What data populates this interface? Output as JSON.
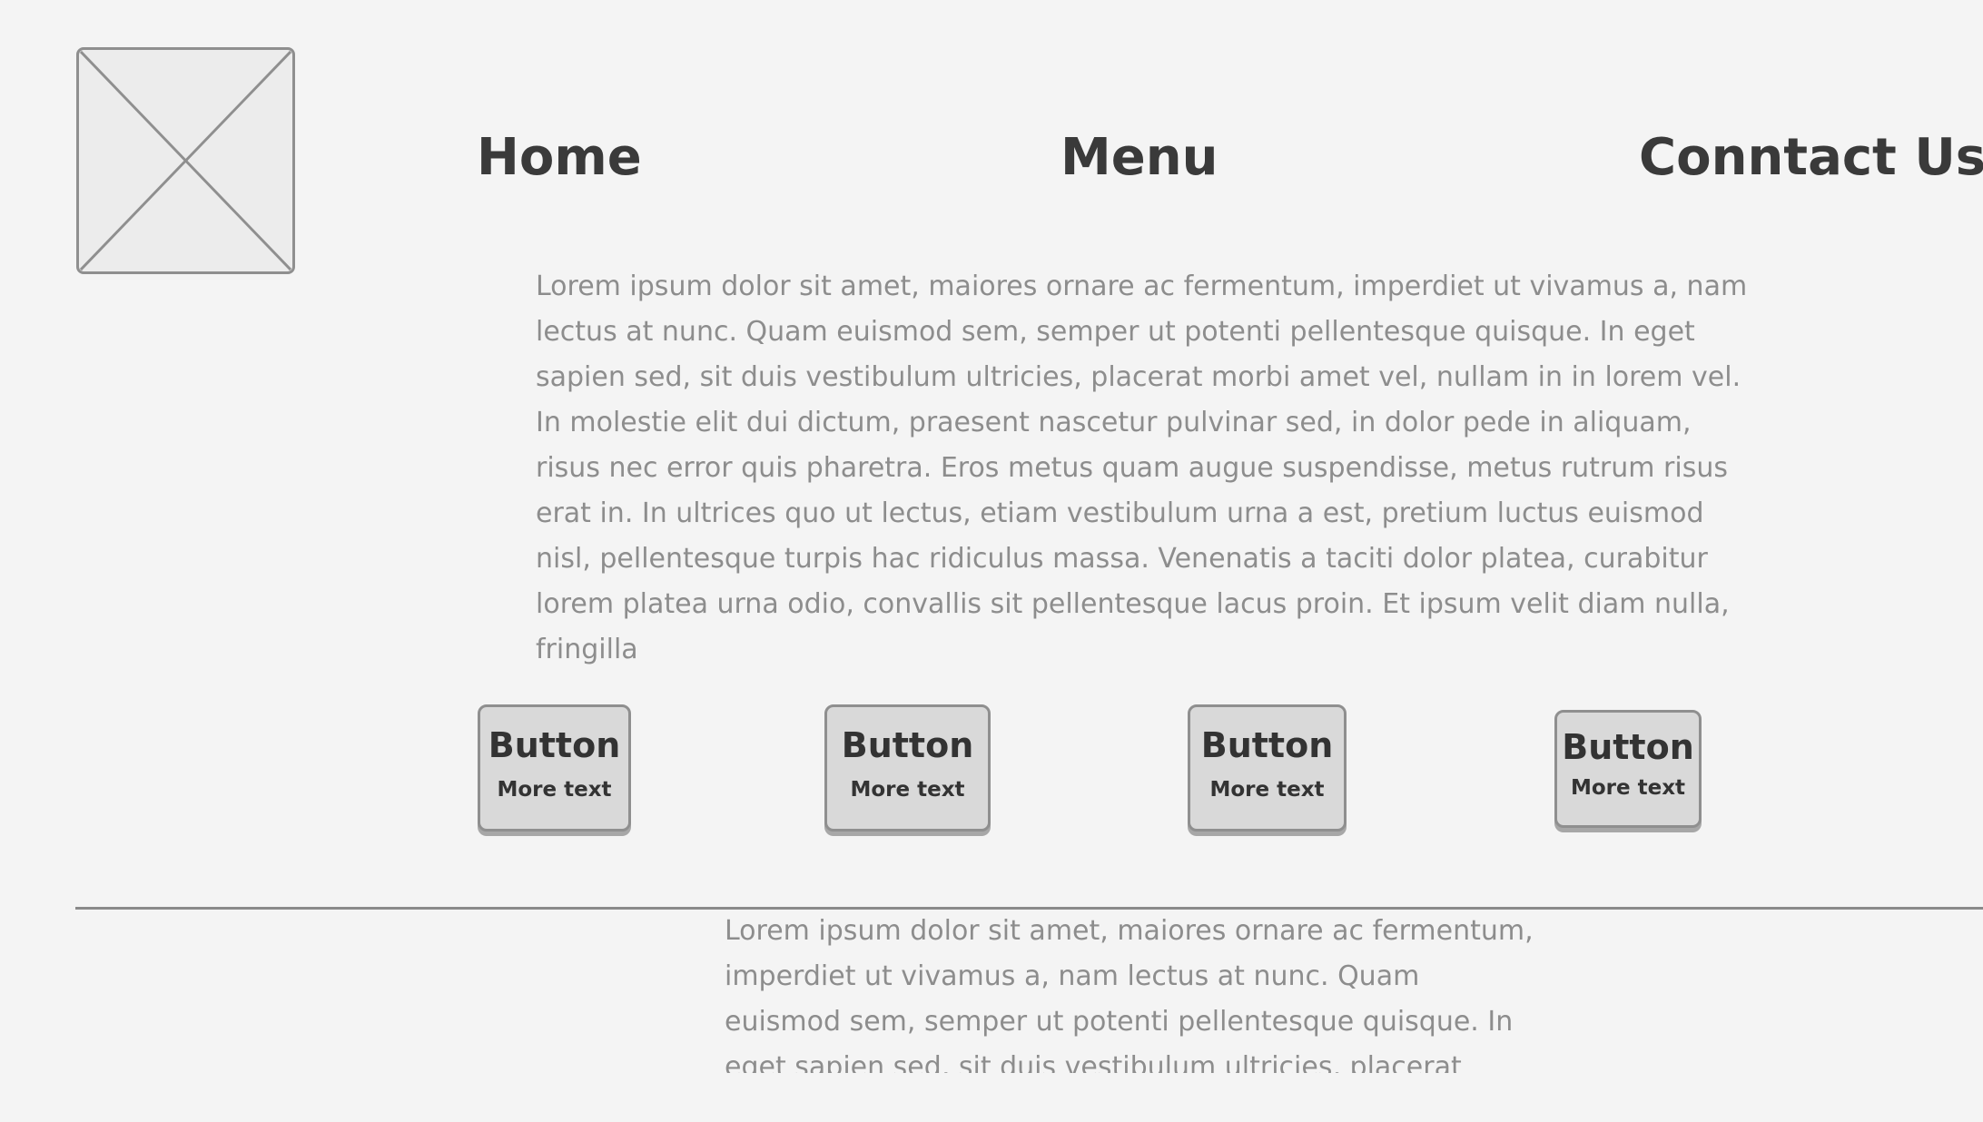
{
  "header": {
    "logo_icon": "image-placeholder-icon",
    "nav": {
      "home": "Home",
      "menu": "Menu",
      "contact": "Conntact Us"
    }
  },
  "intro": {
    "text": "Lorem ipsum dolor sit amet, maiores ornare ac fermentum, imperdiet ut vivamus a, nam lectus at nunc. Quam euismod sem, semper ut potenti pellentesque quisque. In eget sapien sed, sit duis vestibulum ultricies, placerat morbi amet vel, nullam in in lorem vel. In molestie elit dui dictum, praesent nascetur pulvinar sed, in dolor pede in aliquam, risus nec error quis pharetra. Eros metus quam augue suspendisse, metus rutrum risus erat in.  In ultrices quo ut lectus, etiam vestibulum urna a est, pretium luctus euismod nisl, pellentesque turpis hac ridiculus massa. Venenatis a taciti dolor platea, curabitur lorem platea urna odio, convallis sit pellentesque lacus proin. Et ipsum velit diam nulla, fringilla"
  },
  "buttons": [
    {
      "title": "Button",
      "sub": "More text"
    },
    {
      "title": "Button",
      "sub": "More text"
    },
    {
      "title": "Button",
      "sub": "More text"
    },
    {
      "title": "Button",
      "sub": "More text"
    }
  ],
  "footer": {
    "text": "Lorem ipsum dolor sit amet, maiores ornare ac fermentum, imperdiet ut vivamus a, nam lectus at nunc. Quam euismod sem, semper ut potenti pellentesque quisque. In eget sapien sed, sit duis vestibulum ultricies, placerat morbi amet vel,"
  },
  "colors": {
    "background": "#f4f4f4",
    "heading": "#3a3a3a",
    "body_text": "#8d8d8d",
    "button_fill": "#d9d9d9",
    "border": "#8f8f8f"
  }
}
